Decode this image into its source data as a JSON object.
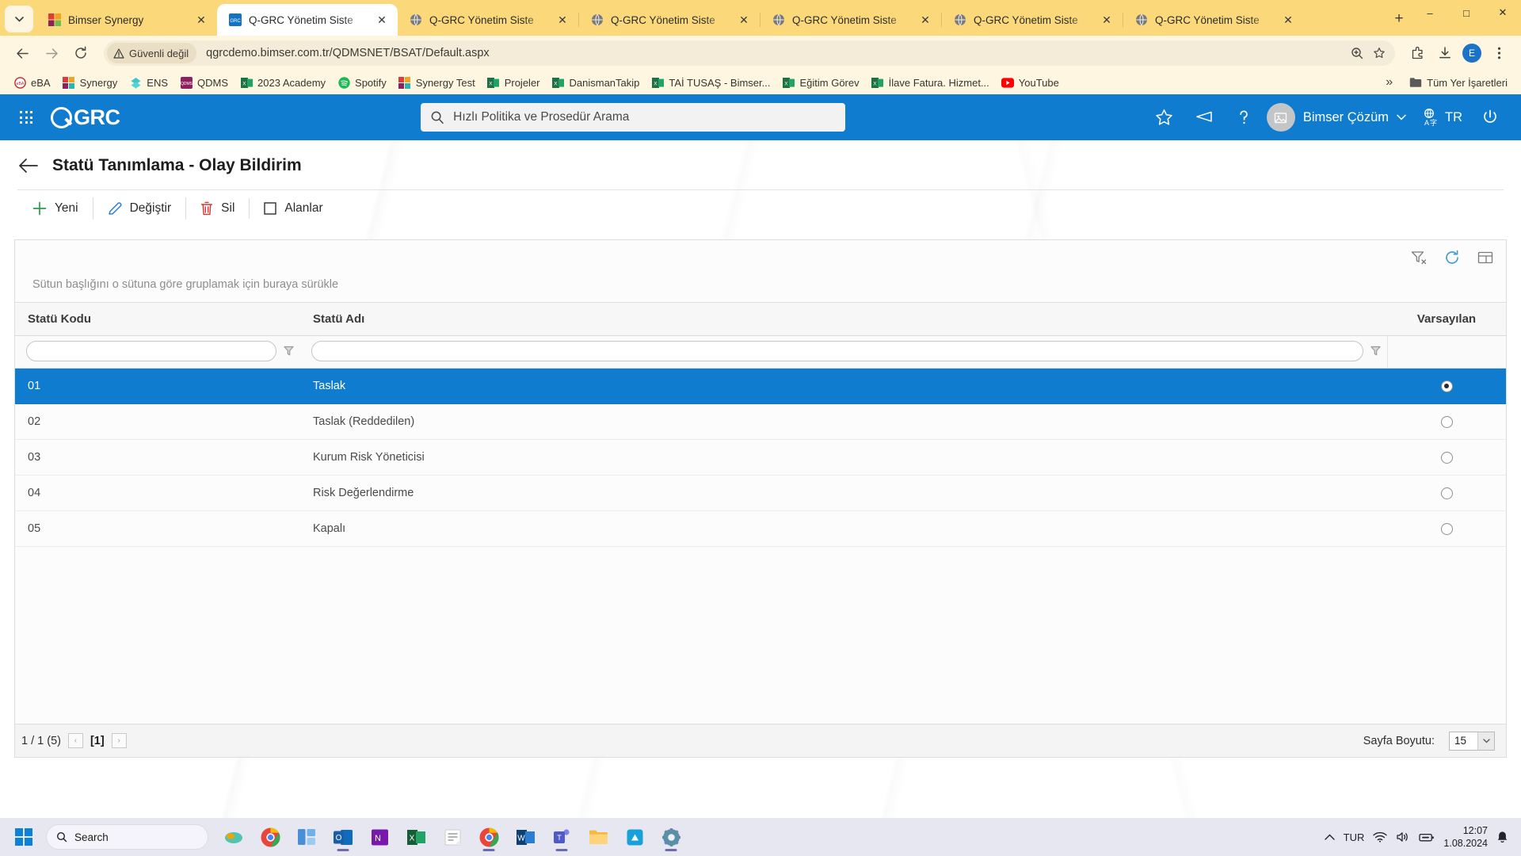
{
  "browser": {
    "tabs": [
      {
        "title": "Bimser Synergy",
        "favicon": "bimser-logo",
        "active": false
      },
      {
        "title": "Q-GRC Yönetim Siste",
        "favicon": "qgrc-logo",
        "active": true
      },
      {
        "title": "Q-GRC Yönetim Siste",
        "favicon": "globe",
        "active": false
      },
      {
        "title": "Q-GRC Yönetim Siste",
        "favicon": "globe",
        "active": false
      },
      {
        "title": "Q-GRC Yönetim Siste",
        "favicon": "globe",
        "active": false
      },
      {
        "title": "Q-GRC Yönetim Siste",
        "favicon": "globe",
        "active": false
      },
      {
        "title": "Q-GRC Yönetim Siste",
        "favicon": "globe",
        "active": false
      }
    ],
    "new_tab_label": "+",
    "tab_list_icon": "chevron-down-icon",
    "window_controls": {
      "minimize": "–",
      "maximize": "□",
      "close": "✕"
    },
    "nav": {
      "back": "back-icon",
      "forward": "forward-icon",
      "reload": "reload-icon"
    },
    "security_label": "Güvenli değil",
    "url": "qgrcdemo.bimser.com.tr/QDMSNET/BSAT/Default.aspx",
    "profile_initial": "E",
    "bookmarks": [
      {
        "label": "eBA",
        "icon": "eba-icon"
      },
      {
        "label": "Synergy",
        "icon": "bimser-icon"
      },
      {
        "label": "ENS",
        "icon": "ens-icon"
      },
      {
        "label": "QDMS",
        "icon": "qdms-icon"
      },
      {
        "label": "2023 Academy",
        "icon": "excel-icon"
      },
      {
        "label": "Spotify",
        "icon": "spotify-icon"
      },
      {
        "label": "Synergy Test",
        "icon": "bimser-icon"
      },
      {
        "label": "Projeler",
        "icon": "excel-icon"
      },
      {
        "label": "DanismanTakip",
        "icon": "excel-icon"
      },
      {
        "label": "TAİ TUSAŞ - Bimser...",
        "icon": "excel-icon"
      },
      {
        "label": "Eğitim Görev",
        "icon": "excel-icon"
      },
      {
        "label": "İlave Fatura. Hizmet...",
        "icon": "excel-icon"
      },
      {
        "label": "YouTube",
        "icon": "youtube-icon"
      }
    ],
    "bookmarks_overflow": "»",
    "all_bookmarks_label": "Tüm Yer İşaretleri"
  },
  "appbar": {
    "logo_text": "GRC",
    "search_placeholder": "Hızlı Politika ve Prosedür Arama",
    "user_name": "Bimser Çözüm",
    "language": "TR",
    "icons": {
      "apps": "waffle-icon",
      "search": "search-icon",
      "favorites": "star-icon",
      "announcements": "megaphone-icon",
      "help": "question-icon",
      "translate": "translate-icon",
      "power": "power-icon",
      "user_chevron": "chevron-down-icon"
    }
  },
  "page": {
    "title": "Statü Tanımlama - Olay Bildirim",
    "back_icon": "back-arrow-icon",
    "commands": [
      {
        "label": "Yeni",
        "icon": "plus-icon",
        "color": "#2d9c4a"
      },
      {
        "label": "Değiştir",
        "icon": "pencil-icon",
        "color": "#1f7ad4"
      },
      {
        "label": "Sil",
        "icon": "trash-icon",
        "color": "#e03131"
      },
      {
        "label": "Alanlar",
        "icon": "square-icon",
        "color": "#3c3c3c"
      }
    ]
  },
  "grid": {
    "tools": [
      {
        "name": "clear-filter-icon"
      },
      {
        "name": "refresh-icon"
      },
      {
        "name": "grid-settings-icon"
      }
    ],
    "group_hint": "Sütun başlığını o sütuna göre gruplamak için buraya sürükle",
    "columns": [
      {
        "key": "code",
        "label": "Statü Kodu"
      },
      {
        "key": "name",
        "label": "Statü Adı"
      },
      {
        "key": "default",
        "label": "Varsayılan"
      }
    ],
    "filters": {
      "code": "",
      "name": "",
      "filter_icon": "funnel-icon"
    },
    "rows": [
      {
        "code": "01",
        "name": "Taslak",
        "default": true,
        "selected": true
      },
      {
        "code": "02",
        "name": "Taslak (Reddedilen)",
        "default": false,
        "selected": false
      },
      {
        "code": "03",
        "name": "Kurum Risk Yöneticisi",
        "default": false,
        "selected": false
      },
      {
        "code": "04",
        "name": "Risk Değerlendirme",
        "default": false,
        "selected": false
      },
      {
        "code": "05",
        "name": "Kapalı",
        "default": false,
        "selected": false
      }
    ],
    "footer": {
      "page_info": "1 / 1 (5)",
      "prev": "‹",
      "current_page": "[1]",
      "next": "›",
      "page_size_label": "Sayfa Boyutu:",
      "page_size_value": "15"
    },
    "selection_color": "#0f7cd0"
  },
  "taskbar": {
    "start_icon": "windows-icon",
    "search_placeholder": "Search",
    "apps": [
      {
        "name": "copilot-icon",
        "running": false
      },
      {
        "name": "chrome-icon",
        "running": false
      },
      {
        "name": "widgets-icon",
        "running": false
      },
      {
        "name": "outlook-icon",
        "running": true
      },
      {
        "name": "onenote-icon",
        "running": false
      },
      {
        "name": "excel-icon",
        "running": false
      },
      {
        "name": "sticky-notes-icon",
        "running": false
      },
      {
        "name": "chrome-active-icon",
        "running": true
      },
      {
        "name": "word-icon",
        "running": false
      },
      {
        "name": "teams-icon",
        "running": true
      },
      {
        "name": "file-explorer-icon",
        "running": false
      },
      {
        "name": "store-icon",
        "running": false
      },
      {
        "name": "settings-icon",
        "running": true
      }
    ],
    "tray": {
      "overflow": "^",
      "language": "TUR",
      "wifi": "wifi-icon",
      "volume": "volume-icon",
      "battery": "battery-icon",
      "notification": "bell-icon"
    },
    "time": "12:07",
    "date": "1.08.2024"
  }
}
